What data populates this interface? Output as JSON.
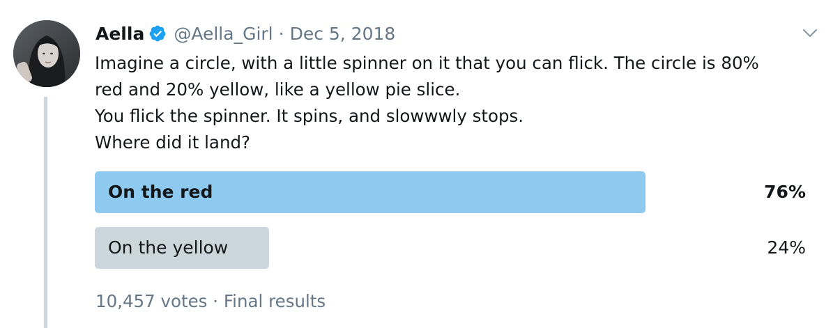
{
  "tweet": {
    "author": {
      "display_name": "Aella",
      "handle": "@Aella_Girl",
      "verified": true
    },
    "separator": "·",
    "date": "Dec 5, 2018",
    "text_lines": [
      "Imagine a circle, with a little spinner on it that you can flick. The circle is 80%",
      "red and 20% yellow, like a yellow pie slice.",
      "You flick the spinner. It spins, and slowwwly stops.",
      "Where did it land?"
    ]
  },
  "poll": {
    "options": [
      {
        "label": "On the red",
        "percent": "76%",
        "fraction": 0.76,
        "winner": true
      },
      {
        "label": "On the yellow",
        "percent": "24%",
        "fraction": 0.24,
        "winner": false
      }
    ],
    "votes": "10,457 votes",
    "separator": "·",
    "status": "Final results"
  },
  "colors": {
    "winner_bar": "#8ec9f0",
    "other_bar": "#ccd6dd",
    "muted_text": "#657786",
    "verified_blue": "#1da1f2"
  },
  "icons": {
    "verified": "verified-badge-icon",
    "menu": "chevron-down-icon"
  }
}
